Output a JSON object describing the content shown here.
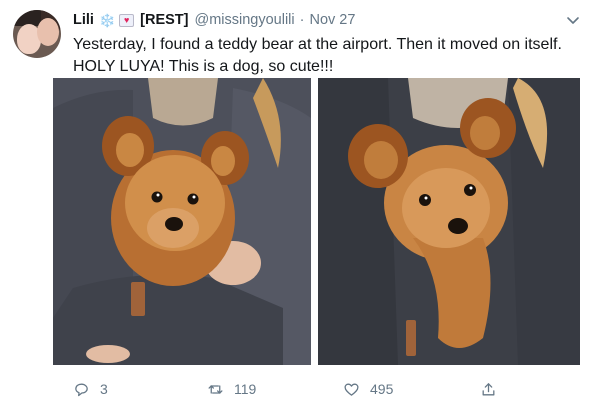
{
  "tweet": {
    "display_name": "Lili",
    "badge_label": "[REST]",
    "handle": "@missingyoulili",
    "separator": "·",
    "timestamp": "Nov 27",
    "emoji_snow": "❄️",
    "emoji_heart": "💌",
    "text": "Yesterday, I found a teddy bear at the airport. Then it moved on itself. HOLY LUYA! This is a dog, so cute!!!",
    "actions": {
      "reply_count": "3",
      "retweet_count": "119",
      "like_count": "495"
    }
  },
  "icons": {
    "caret": "chevron-down-icon",
    "reply": "reply-icon",
    "retweet": "retweet-icon",
    "like": "heart-icon",
    "share": "share-icon"
  },
  "colors": {
    "text_primary": "#14171a",
    "text_secondary": "#657786",
    "like_accent": "#e0245e"
  }
}
